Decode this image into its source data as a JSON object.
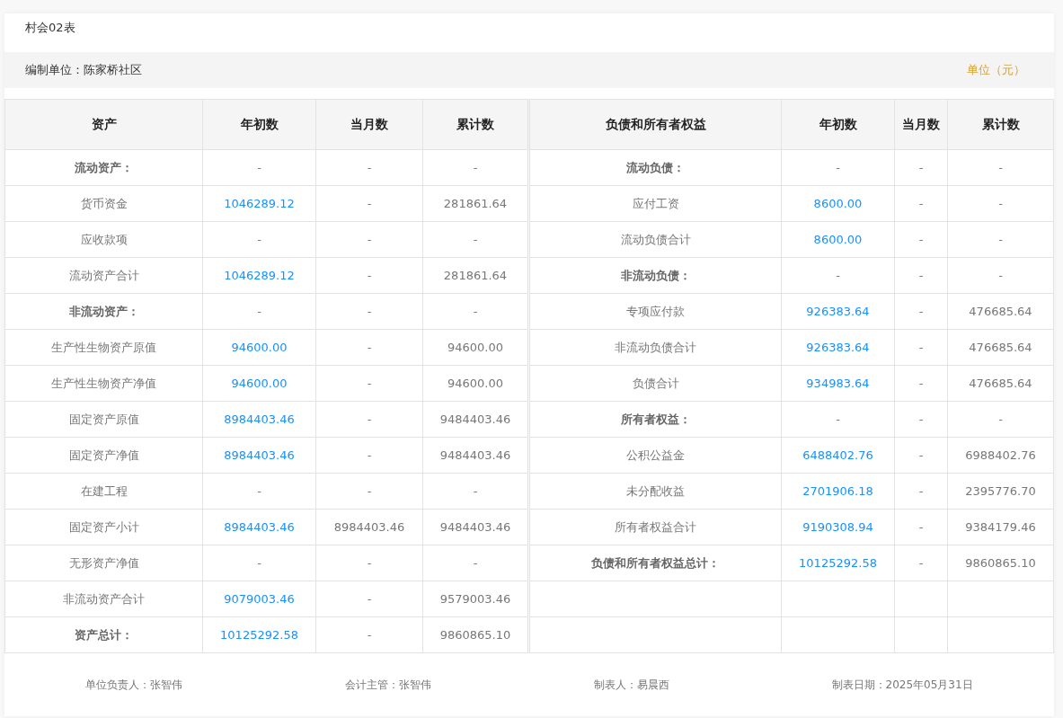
{
  "title": "村会02表",
  "info_bar": {
    "unit_org": "编制单位：陈家桥社区",
    "currency": "单位（元）"
  },
  "table": {
    "columns": [
      "资产",
      "年初数",
      "当月数",
      "累计数",
      "负债和所有者权益",
      "年初数",
      "当月数",
      "累计数"
    ],
    "rows": [
      {
        "left": {
          "kind": "section",
          "label": "流动资产：",
          "opening": "-",
          "month": "-",
          "cumulative": "-"
        },
        "right": {
          "kind": "section",
          "label": "流动负债：",
          "opening": "-",
          "month": "-",
          "cumulative": "-"
        }
      },
      {
        "left": {
          "kind": "item",
          "label": "货币资金",
          "opening": "1046289.12",
          "month": "-",
          "cumulative": "281861.64"
        },
        "right": {
          "kind": "item",
          "label": "应付工资",
          "opening": "8600.00",
          "month": "-",
          "cumulative": "-"
        }
      },
      {
        "left": {
          "kind": "item",
          "label": "应收款项",
          "opening": "-",
          "month": "-",
          "cumulative": "-"
        },
        "right": {
          "kind": "item",
          "label": "流动负债合计",
          "opening": "8600.00",
          "month": "-",
          "cumulative": "-"
        }
      },
      {
        "left": {
          "kind": "item",
          "label": "流动资产合计",
          "opening": "1046289.12",
          "month": "-",
          "cumulative": "281861.64"
        },
        "right": {
          "kind": "section",
          "label": "非流动负债：",
          "opening": "-",
          "month": "-",
          "cumulative": "-"
        }
      },
      {
        "left": {
          "kind": "section",
          "label": "非流动资产：",
          "opening": "-",
          "month": "-",
          "cumulative": "-"
        },
        "right": {
          "kind": "item",
          "label": "专项应付款",
          "opening": "926383.64",
          "month": "-",
          "cumulative": "476685.64"
        }
      },
      {
        "left": {
          "kind": "item",
          "label": "生产性生物资产原值",
          "opening": "94600.00",
          "month": "-",
          "cumulative": "94600.00"
        },
        "right": {
          "kind": "item",
          "label": "非流动负债合计",
          "opening": "926383.64",
          "month": "-",
          "cumulative": "476685.64"
        }
      },
      {
        "left": {
          "kind": "item",
          "label": "生产性生物资产净值",
          "opening": "94600.00",
          "month": "-",
          "cumulative": "94600.00"
        },
        "right": {
          "kind": "item",
          "label": "负债合计",
          "opening": "934983.64",
          "month": "-",
          "cumulative": "476685.64"
        }
      },
      {
        "left": {
          "kind": "item",
          "label": "固定资产原值",
          "opening": "8984403.46",
          "month": "-",
          "cumulative": "9484403.46"
        },
        "right": {
          "kind": "section",
          "label": "所有者权益：",
          "opening": "-",
          "month": "-",
          "cumulative": "-"
        }
      },
      {
        "left": {
          "kind": "item",
          "label": "固定资产净值",
          "opening": "8984403.46",
          "month": "-",
          "cumulative": "9484403.46"
        },
        "right": {
          "kind": "item",
          "label": "公积公益金",
          "opening": "6488402.76",
          "month": "-",
          "cumulative": "6988402.76"
        }
      },
      {
        "left": {
          "kind": "item",
          "label": "在建工程",
          "opening": "-",
          "month": "-",
          "cumulative": "-"
        },
        "right": {
          "kind": "item",
          "label": "未分配收益",
          "opening": "2701906.18",
          "month": "-",
          "cumulative": "2395776.70"
        }
      },
      {
        "left": {
          "kind": "item",
          "label": "固定资产小计",
          "opening": "8984403.46",
          "month": "8984403.46",
          "cumulative": "9484403.46"
        },
        "right": {
          "kind": "item",
          "label": "所有者权益合计",
          "opening": "9190308.94",
          "month": "-",
          "cumulative": "9384179.46"
        }
      },
      {
        "left": {
          "kind": "item",
          "label": "无形资产净值",
          "opening": "-",
          "month": "-",
          "cumulative": "-"
        },
        "right": {
          "kind": "section",
          "label": "负债和所有者权益总计：",
          "opening": "10125292.58",
          "month": "-",
          "cumulative": "9860865.10"
        }
      },
      {
        "left": {
          "kind": "item",
          "label": "非流动资产合计",
          "opening": "9079003.46",
          "month": "-",
          "cumulative": "9579003.46"
        }
      },
      {
        "left": {
          "kind": "section",
          "label": "资产总计：",
          "opening": "10125292.58",
          "month": "-",
          "cumulative": "9860865.10"
        }
      }
    ]
  },
  "footer": [
    "单位负责人：张智伟",
    "会计主管：张智伟",
    "制表人：易晨西",
    "制表日期：2025年05月31日"
  ]
}
